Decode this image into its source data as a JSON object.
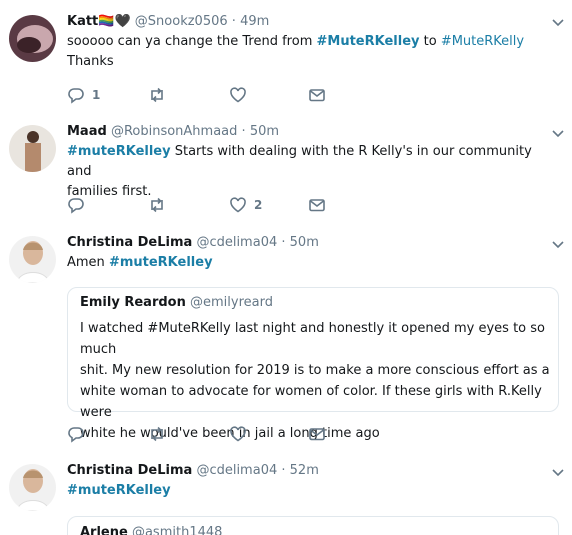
{
  "tweets": [
    {
      "name": "Katt",
      "name_emoji": "🏳️‍🌈🖤",
      "handle": "@Snookz0506",
      "dot": "·",
      "time": "49m",
      "text_pre": "sooooo can ya change the Trend from ",
      "tag1": "#MuteRKelley",
      "text_mid": " to ",
      "tag2": "#MuteRKelly",
      "text_line2": "Thanks",
      "reply_count": "1",
      "retweet_count": "",
      "like_count": ""
    },
    {
      "name": "Maad",
      "handle": "@RobinsonAhmaad",
      "dot": "·",
      "time": "50m",
      "tag": "#muteRKelley",
      "text_line1": " Starts with dealing with the R Kelly's in our community and",
      "text_line2": "families first.",
      "reply_count": "",
      "retweet_count": "",
      "like_count": "2"
    },
    {
      "name": "Christina DeLima",
      "handle": "@cdelima04",
      "dot": "·",
      "time": "50m",
      "text_pre": "Amen ",
      "tag": "#muteRKelley",
      "quote": {
        "name": "Emily Reardon",
        "handle": "@emilyreard",
        "line1": "I watched #MuteRKelly last night and honestly it opened my eyes to so much",
        "line2": "shit. My new resolution for 2019 is to make a more conscious effort as a",
        "line3": "white woman to advocate for women of color. If these girls with R.Kelly were",
        "line4": "white he would've been in jail a long time ago"
      }
    },
    {
      "name": "Christina DeLima",
      "handle": "@cdelima04",
      "dot": "·",
      "time": "52m",
      "tag": "#muteRKelley",
      "quote": {
        "name": "Arlene",
        "handle": "@asmith1448"
      }
    }
  ],
  "icons": {
    "reply": "reply-icon",
    "retweet": "retweet-icon",
    "like": "heart-icon",
    "message": "envelope-icon",
    "caret": "chevron-down-icon"
  },
  "colors": {
    "hashtag": "#1b7ea6",
    "muted": "#657786",
    "border": "#e6ecf0"
  }
}
